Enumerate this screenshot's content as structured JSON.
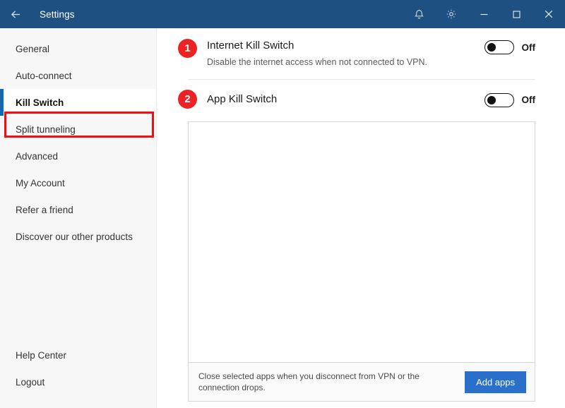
{
  "window": {
    "title": "Settings",
    "back_icon": "back-arrow-icon",
    "titlebar_color": "#1e5082",
    "icons": {
      "notifications": "bell-icon",
      "settings": "gear-icon",
      "minimize": "minimize-icon",
      "maximize": "maximize-icon",
      "close": "close-icon"
    }
  },
  "sidebar": {
    "items": [
      {
        "label": "General",
        "selected": false
      },
      {
        "label": "Auto-connect",
        "selected": false
      },
      {
        "label": "Kill Switch",
        "selected": true
      },
      {
        "label": "Split tunneling",
        "selected": false
      },
      {
        "label": "Advanced",
        "selected": false
      },
      {
        "label": "My Account",
        "selected": false
      },
      {
        "label": "Refer a friend",
        "selected": false
      },
      {
        "label": "Discover our other products",
        "selected": false
      }
    ],
    "bottom_items": [
      {
        "label": "Help Center"
      },
      {
        "label": "Logout"
      }
    ],
    "selected_accent_color": "#1268b3",
    "annotation_color": "#ee1111"
  },
  "main": {
    "internet_kill_switch": {
      "badge": "1",
      "title": "Internet Kill Switch",
      "subtitle": "Disable the internet access when not connected to VPN.",
      "toggle_state": "Off"
    },
    "app_kill_switch": {
      "badge": "2",
      "title": "App Kill Switch",
      "toggle_state": "Off"
    },
    "app_list": {
      "items": [],
      "footer_note": "Close selected apps when you disconnect from VPN or the connection drops.",
      "add_button_label": "Add apps",
      "add_button_color": "#2a6fc9"
    }
  }
}
